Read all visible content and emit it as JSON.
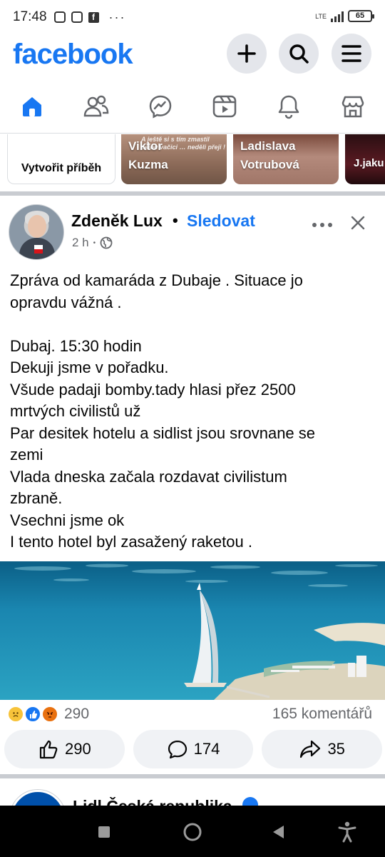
{
  "status_bar": {
    "time": "17:48",
    "network": "LTE",
    "battery": "65",
    "more": "···"
  },
  "header": {
    "logo": "facebook",
    "buttons": [
      "plus-icon",
      "search-icon",
      "menu-icon"
    ]
  },
  "tabs": [
    {
      "name": "home",
      "icon": "home-icon",
      "active": true
    },
    {
      "name": "friends",
      "icon": "friends-icon"
    },
    {
      "name": "messenger",
      "icon": "messenger-icon"
    },
    {
      "name": "video",
      "icon": "video-icon"
    },
    {
      "name": "notifications",
      "icon": "bell-icon"
    },
    {
      "name": "marketplace",
      "icon": "marketplace-icon"
    }
  ],
  "stories": {
    "create_label": "Vytvořit příběh",
    "items": [
      {
        "name": "Viktor Kuzma",
        "overlay": "A ještě si s tím zmastil celou vačici … neděli přeji !"
      },
      {
        "name": "Ladislava Votrubová"
      },
      {
        "name": "J.jaku"
      }
    ]
  },
  "post": {
    "author": "Zdeněk Lux",
    "separator": "•",
    "follow_label": "Sledovat",
    "time": "2 h",
    "meta_dot": "•",
    "text": "Zpráva od kamaráda z Dubaje . Situace jo\nopravdu vážná .\n\nDubaj. 15:30 hodin\nDekuji jsme v pořadku.\nVšude padaji bomby.tady hlasi přez 2500\nmrtvých civilistů už\nPar desitek hotelu a sidlist jsou srovnane se\nzemi\nVlada dneska začala rozdavat civilistum\nzbraně.\nVsechni jsme ok\nI tento hotel byl zasažený raketou .",
    "reaction_count": "290",
    "comments_label": "165 komentářů",
    "actions": {
      "like": "290",
      "comment": "174",
      "share": "35"
    }
  },
  "next_post": {
    "author": "Lidl Česká republika"
  },
  "colors": {
    "brand": "#1877f2",
    "secondary_text": "#65676b",
    "button_bg": "#e4e6eb"
  }
}
